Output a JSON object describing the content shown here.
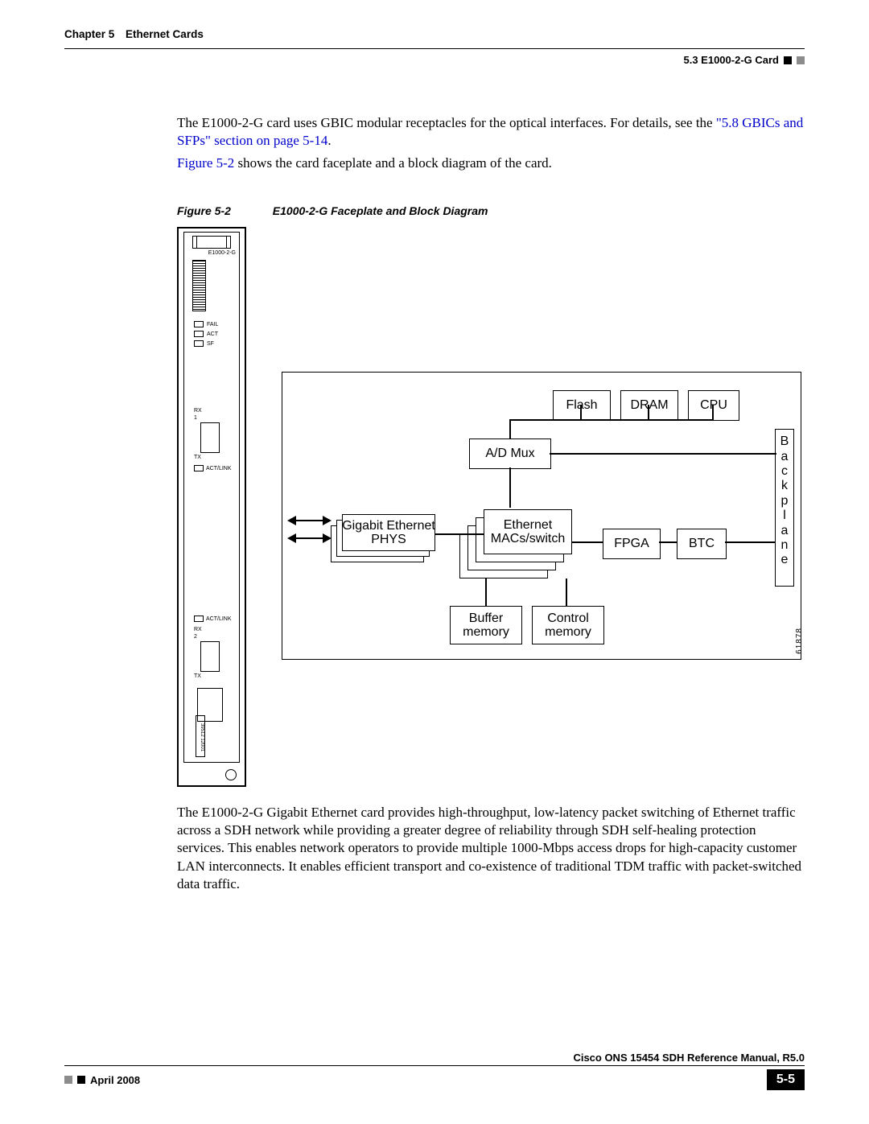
{
  "header": {
    "chapter_label": "Chapter 5",
    "chapter_title": "Ethernet Cards",
    "section_label": "5.3  E1000-2-G Card"
  },
  "intro": {
    "p1_a": "The E1000-2-G card uses GBIC modular receptacles for the optical interfaces. For details, see the ",
    "p1_link": "\"5.8  GBICs and SFPs\" section on page 5-14",
    "p1_b": ".",
    "p2_link": "Figure 5-2",
    "p2_rest": " shows the card faceplate and a block diagram of the card."
  },
  "figure": {
    "number": "Figure 5-2",
    "title": "E1000-2-G Faceplate and Block Diagram",
    "drawing_id": "61878"
  },
  "faceplate": {
    "card_label": "E1000-2-G",
    "leds": [
      "FAIL",
      "ACT",
      "SF"
    ],
    "port1": {
      "rx": "RX",
      "num": "1",
      "tx": "TX",
      "actlink": "ACT/LINK"
    },
    "port2": {
      "rx": "RX",
      "num": "2",
      "tx": "TX",
      "actlink": "ACT/LINK"
    },
    "serial": "39512 12001"
  },
  "diagram": {
    "flash": "Flash",
    "dram": "DRAM",
    "cpu": "CPU",
    "admux": "A/D Mux",
    "phys": "Gigabit Ethernet\nPHYS",
    "macs": "Ethernet\nMACs/switch",
    "fpga": "FPGA",
    "btc": "BTC",
    "bufmem": "Buffer\nmemory",
    "ctlmem": "Control\nmemory",
    "backplane": "Backplane"
  },
  "body_after": "The E1000-2-G Gigabit Ethernet card provides high-throughput, low-latency packet switching of Ethernet traffic across a SDH network while providing a greater degree of reliability through SDH self-healing protection services. This enables network operators to provide multiple 1000-Mbps access drops for high-capacity customer LAN interconnects. It enables efficient transport and co-existence of traditional TDM traffic with packet-switched data traffic.",
  "footer": {
    "manual": "Cisco ONS 15454 SDH Reference Manual, R5.0",
    "date": "April 2008",
    "page": "5-5"
  }
}
